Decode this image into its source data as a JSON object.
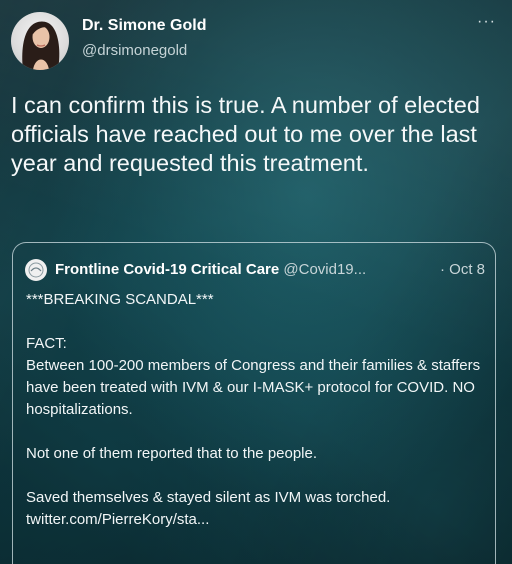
{
  "author": {
    "display_name": "Dr. Simone Gold",
    "handle": "@drsimonegold"
  },
  "menu_icon": "more-horizontal-icon",
  "menu_glyph": "···",
  "tweet_text": "I can confirm this is true. A number of elected officials have reached out to me over the last year and requested this treatment.",
  "quoted_tweet": {
    "display_name": "Frontline Covid-19 Critical Care",
    "handle": "@Covid19...",
    "date": "· Oct 8",
    "lines": [
      "***BREAKING SCANDAL***",
      "",
      "FACT:",
      "Between 100-200 members of Congress and their families & staffers have been treated with IVM & our I-MASK+ protocol for COVID. NO hospitalizations.",
      "",
      "Not one of them reported that to the people.",
      "",
      "Saved themselves & stayed silent as IVM was torched.",
      "twitter.com/PierreKory/sta..."
    ]
  }
}
